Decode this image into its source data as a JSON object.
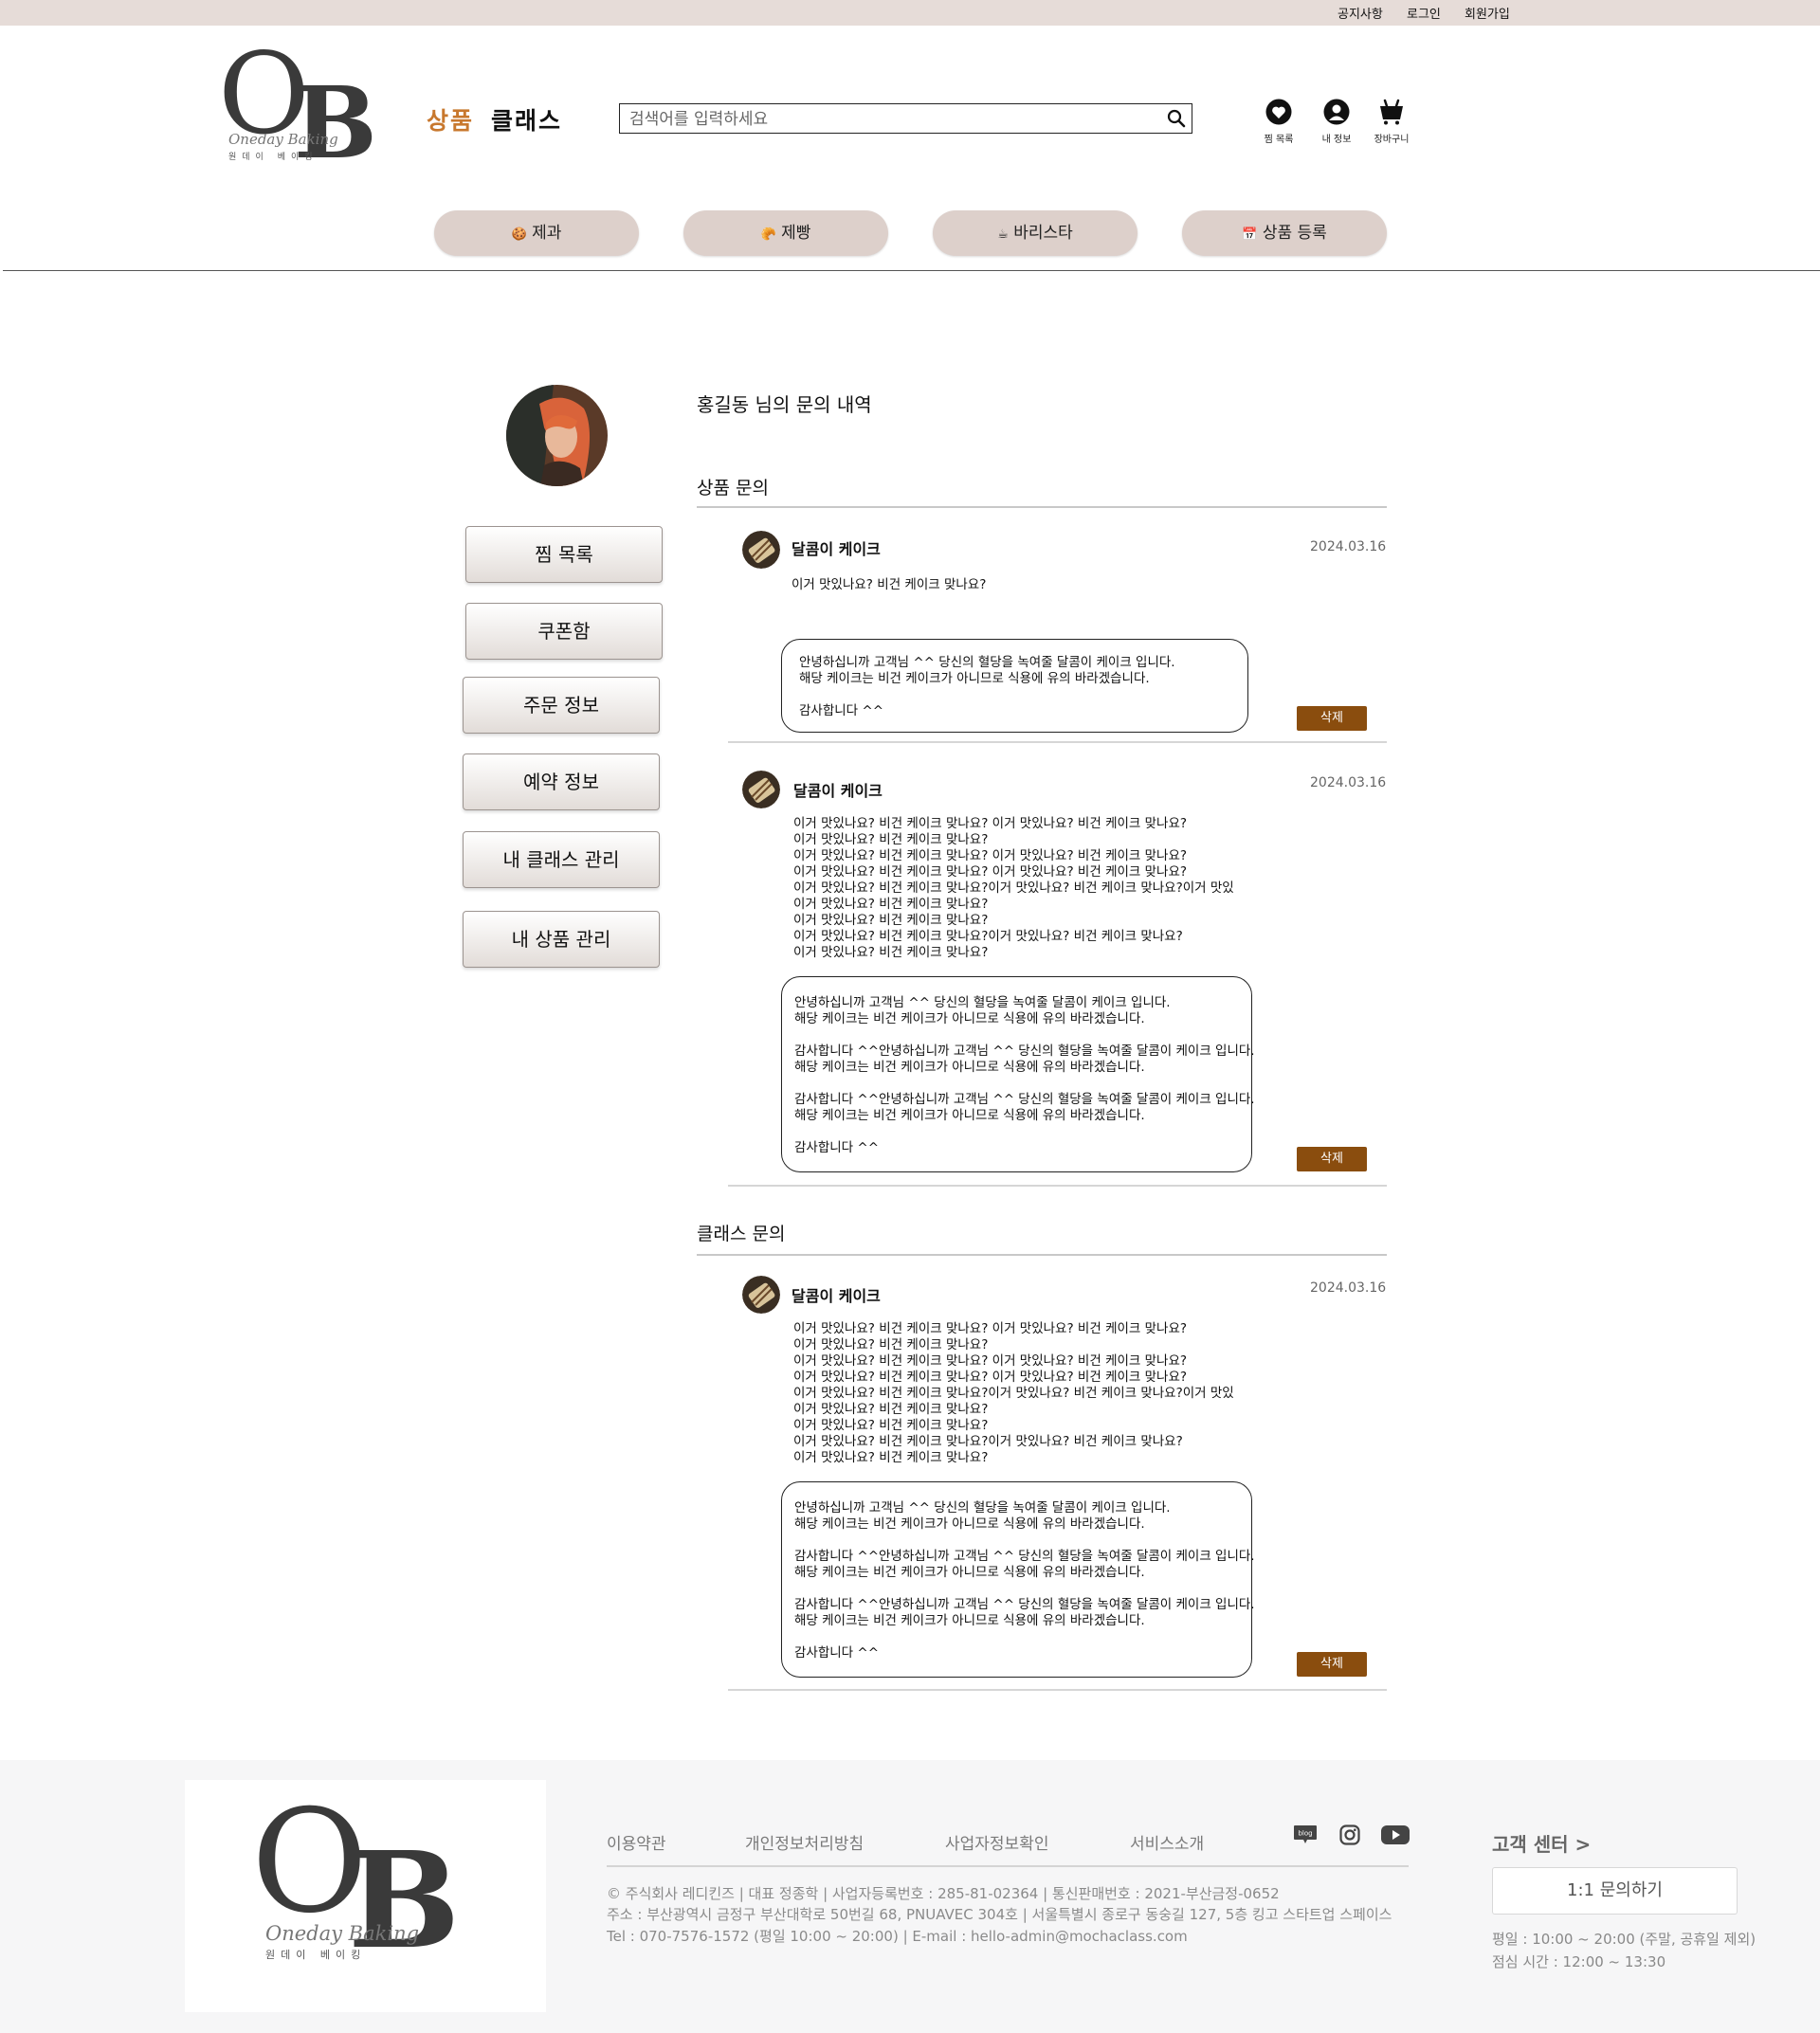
{
  "topbar": {
    "notice": "공지사항",
    "login": "로그인",
    "signup": "회원가입"
  },
  "logo": {
    "letters_o": "O",
    "letters_b": "B",
    "script": "Oneday Baking",
    "sub": "원데이 베이킹"
  },
  "nav": {
    "product": "상품",
    "class": "클래스"
  },
  "search": {
    "placeholder": "검색어를 입력하세요"
  },
  "header_icons": {
    "wishlist": "찜 목록",
    "myinfo": "내 정보",
    "cart": "장바구니"
  },
  "categories": [
    {
      "icon": "🍪",
      "label": "제과"
    },
    {
      "icon": "🥐",
      "label": "제빵"
    },
    {
      "icon": "☕",
      "label": "바리스타"
    },
    {
      "icon": "📅",
      "label": "상품 등록"
    }
  ],
  "sidebar": {
    "items": [
      "찜 목록",
      "쿠폰함",
      "주문 정보",
      "예약 정보",
      "내 클래스 관리",
      "내 상품 관리"
    ]
  },
  "main": {
    "page_title": "홍길동 님의 문의 내역",
    "product_section": "상품 문의",
    "class_section": "클래스 문의",
    "delete_label": "삭제",
    "inquiries": [
      {
        "title": "달콤이 케이크",
        "date": "2024.03.16",
        "question": "이거 맛있나요? 비건 케이크 맞나요?",
        "answer": "안녕하십니까 고객님 ^^ 당신의 혈당을 녹여줄 달콤이 케이크 입니다.\n해당 케이크는 비건 케이크가 아니므로 식용에 유의 바라겠습니다.\n\n감사합니다 ^^"
      },
      {
        "title": "달콤이 케이크",
        "date": "2024.03.16",
        "question": "이거 맛있나요? 비건 케이크 맞나요? 이거 맛있나요? 비건 케이크 맞나요?\n이거 맛있나요? 비건 케이크 맞나요?\n이거 맛있나요? 비건 케이크 맞나요? 이거 맛있나요? 비건 케이크 맞나요?\n이거 맛있나요? 비건 케이크 맞나요? 이거 맛있나요? 비건 케이크 맞나요?\n이거 맛있나요? 비건 케이크 맞나요?이거 맛있나요? 비건 케이크 맞나요?이거 맛있\n이거 맛있나요? 비건 케이크 맞나요?\n이거 맛있나요? 비건 케이크 맞나요?\n이거 맛있나요? 비건 케이크 맞나요?이거 맛있나요? 비건 케이크 맞나요?\n이거 맛있나요? 비건 케이크 맞나요?",
        "answer": "안녕하십니까 고객님 ^^ 당신의 혈당을 녹여줄 달콤이 케이크 입니다.\n해당 케이크는 비건 케이크가 아니므로 식용에 유의 바라겠습니다.\n\n감사합니다 ^^안녕하십니까 고객님 ^^ 당신의 혈당을 녹여줄 달콤이 케이크 입니다.\n해당 케이크는 비건 케이크가 아니므로 식용에 유의 바라겠습니다.\n\n감사합니다 ^^안녕하십니까 고객님 ^^ 당신의 혈당을 녹여줄 달콤이 케이크 입니다.\n해당 케이크는 비건 케이크가 아니므로 식용에 유의 바라겠습니다.\n\n감사합니다 ^^"
      },
      {
        "title": "달콤이 케이크",
        "date": "2024.03.16",
        "question": "이거 맛있나요? 비건 케이크 맞나요? 이거 맛있나요? 비건 케이크 맞나요?\n이거 맛있나요? 비건 케이크 맞나요?\n이거 맛있나요? 비건 케이크 맞나요? 이거 맛있나요? 비건 케이크 맞나요?\n이거 맛있나요? 비건 케이크 맞나요? 이거 맛있나요? 비건 케이크 맞나요?\n이거 맛있나요? 비건 케이크 맞나요?이거 맛있나요? 비건 케이크 맞나요?이거 맛있\n이거 맛있나요? 비건 케이크 맞나요?\n이거 맛있나요? 비건 케이크 맞나요?\n이거 맛있나요? 비건 케이크 맞나요?이거 맛있나요? 비건 케이크 맞나요?\n이거 맛있나요? 비건 케이크 맞나요?",
        "answer": "안녕하십니까 고객님 ^^ 당신의 혈당을 녹여줄 달콤이 케이크 입니다.\n해당 케이크는 비건 케이크가 아니므로 식용에 유의 바라겠습니다.\n\n감사합니다 ^^안녕하십니까 고객님 ^^ 당신의 혈당을 녹여줄 달콤이 케이크 입니다.\n해당 케이크는 비건 케이크가 아니므로 식용에 유의 바라겠습니다.\n\n감사합니다 ^^안녕하십니까 고객님 ^^ 당신의 혈당을 녹여줄 달콤이 케이크 입니다.\n해당 케이크는 비건 케이크가 아니므로 식용에 유의 바라겠습니다.\n\n감사합니다 ^^"
      }
    ]
  },
  "footer": {
    "links": [
      "이용약관",
      "개인정보처리방침",
      "사업자정보확인",
      "서비스소개"
    ],
    "social": [
      "blog-icon",
      "instagram-icon",
      "youtube-icon"
    ],
    "blog_label": "blog",
    "info_line1": "© 주식회사 레디킨즈 | 대표 정종학 | 사업자등록번호 : 285-81-02364 | 통신판매번호 : 2021-부산금정-0652",
    "info_line2": "주소 : 부산광역시 금정구 부산대학로 50번길 68, PNUAVEC 304호 | 서울특별시 종로구 동숭길 127, 5층 킹고 스타트업 스페이스",
    "info_line3": "Tel : 070-7576-1572 (평일 10:00 ~ 20:00) | E-mail : hello-admin@mochaclass.com",
    "cs_title": "고객 센터 >",
    "cs_button": "1:1 문의하기",
    "cs_hours1": "평일 : 10:00 ~ 20:00 (주말, 공휴일 제외)",
    "cs_hours2": "점심 시간 : 12:00 ~ 13:30"
  },
  "colors": {
    "accent_orange": "#c8782e",
    "delete_brown": "#8a4d0e",
    "category_bg": "#ddd0cb",
    "topbar_bg": "#e6dcd8"
  }
}
